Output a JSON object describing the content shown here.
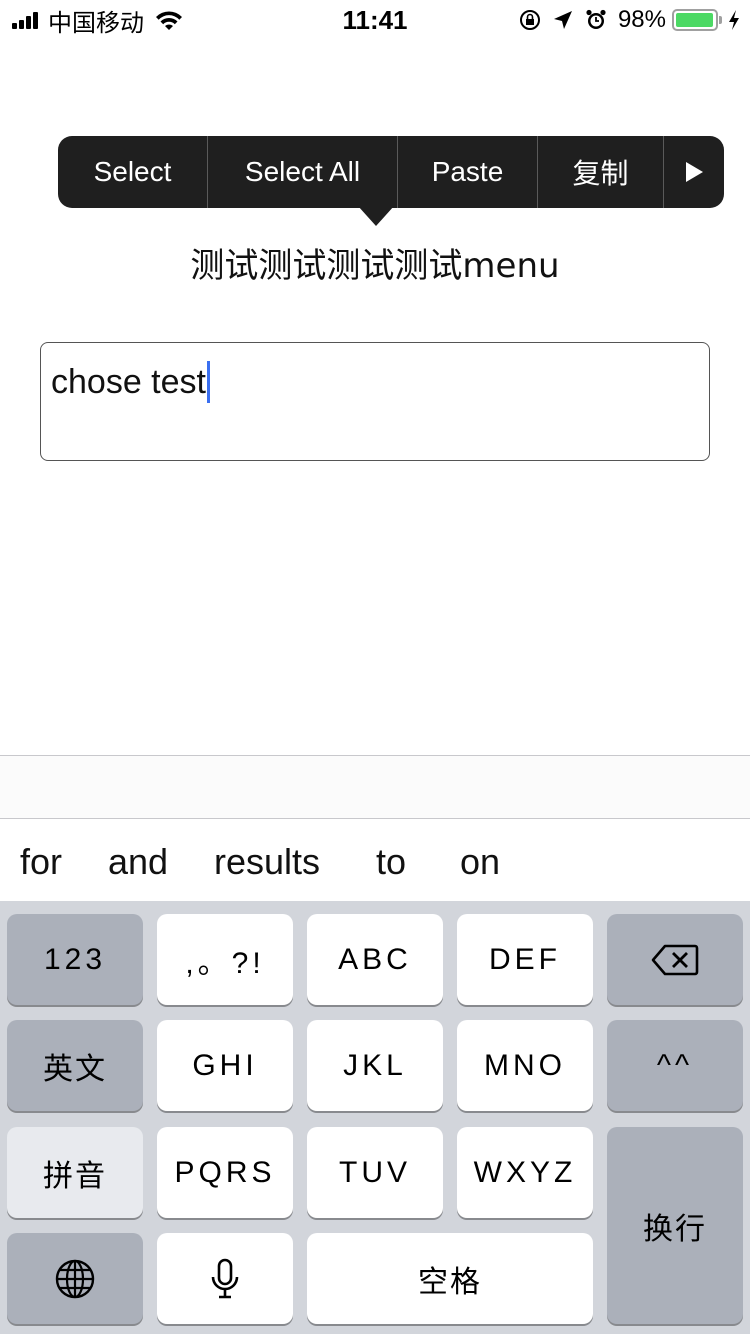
{
  "status_bar": {
    "carrier": "中国移动",
    "time": "11:41",
    "battery_percent": "98%",
    "battery_level": 0.98,
    "colors": {
      "battery": "#4cd964"
    },
    "icons": [
      "signal-icon",
      "wifi-icon",
      "rotation-lock-icon",
      "location-arrow-icon",
      "alarm-icon",
      "battery-icon",
      "charging-icon"
    ]
  },
  "edit_menu": {
    "items": [
      "Select",
      "Select All",
      "Paste",
      "复制"
    ],
    "more_icon": "play-arrow-icon"
  },
  "label": {
    "text": "测试测试测试测试menu"
  },
  "text_view": {
    "value": "chose test",
    "caret_color": "#3a6ff0"
  },
  "suggestions": [
    "for",
    "and",
    "results",
    "to",
    "on"
  ],
  "keyboard": {
    "row1": [
      "123",
      ",。?!",
      "ABC",
      "DEF"
    ],
    "row2": [
      "英文",
      "GHI",
      "JKL",
      "MNO",
      "^^"
    ],
    "row3": [
      "拼音",
      "PQRS",
      "TUV",
      "WXYZ"
    ],
    "return_key": "换行",
    "space_key": "空格",
    "icons": [
      "delete-icon",
      "globe-icon",
      "microphone-icon"
    ]
  }
}
